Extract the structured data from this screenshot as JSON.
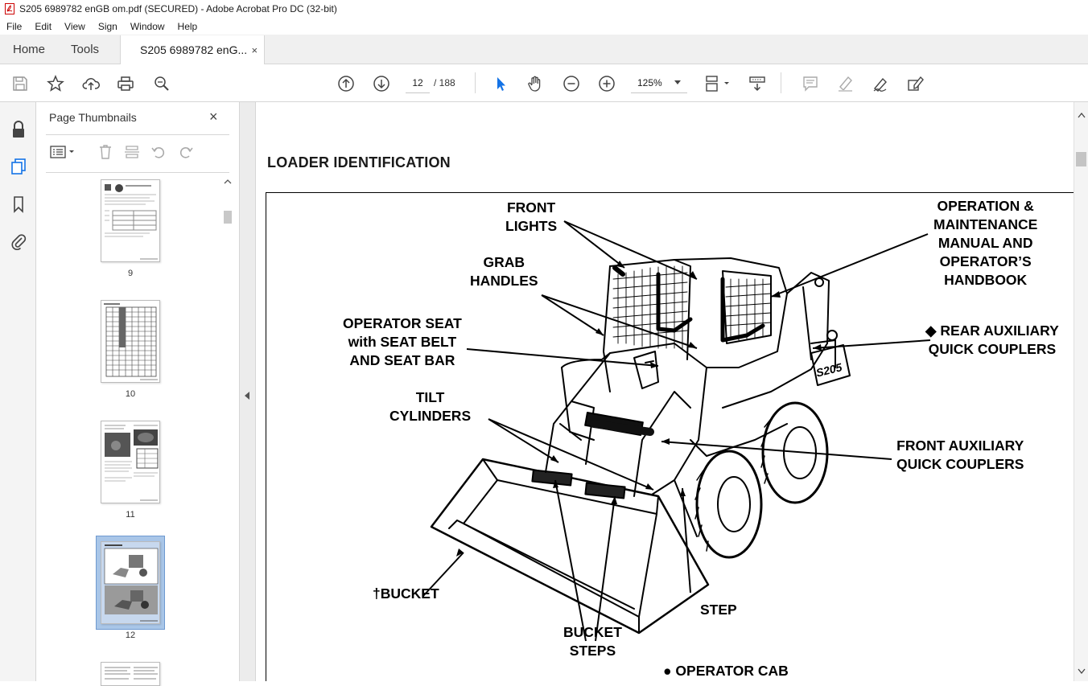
{
  "window": {
    "title": "S205 6989782 enGB om.pdf (SECURED) - Adobe Acrobat Pro DC (32-bit)"
  },
  "menu": [
    "File",
    "Edit",
    "View",
    "Sign",
    "Window",
    "Help"
  ],
  "tabs": {
    "home": "Home",
    "tools": "Tools",
    "document": "S205 6989782 enG...",
    "close": "×"
  },
  "toolbar": {
    "page_current": "12",
    "page_total": "/ 188",
    "zoom": "125%"
  },
  "thumbnails_panel": {
    "title": "Page Thumbnails",
    "close": "×",
    "pages": [
      "9",
      "10",
      "11",
      "12"
    ]
  },
  "document": {
    "heading": "LOADER IDENTIFICATION",
    "labels": {
      "front_lights": [
        "FRONT",
        "LIGHTS"
      ],
      "grab_handles": [
        "GRAB",
        "HANDLES"
      ],
      "operator_seat": [
        "OPERATOR SEAT",
        "with SEAT BELT",
        "AND SEAT BAR"
      ],
      "tilt_cylinders": [
        "TILT",
        "CYLINDERS"
      ],
      "bucket": "†BUCKET",
      "bucket_steps": [
        "BUCKET",
        "STEPS"
      ],
      "step": "STEP",
      "operation_manual": [
        "OPERATION &",
        "MAINTENANCE",
        "MANUAL AND",
        "OPERATOR’S",
        "HANDBOOK"
      ],
      "rear_aux": [
        "◆ REAR AUXILIARY",
        "QUICK COUPLERS"
      ],
      "front_aux": [
        "FRONT AUXILIARY",
        "QUICK COUPLERS"
      ],
      "operator_cab": "● OPERATOR CAB",
      "model_badge": "S205"
    }
  },
  "colors": {
    "chrome_bg": "#f0f0f0",
    "selection": "#a9c6e8",
    "icon": "#555555"
  }
}
